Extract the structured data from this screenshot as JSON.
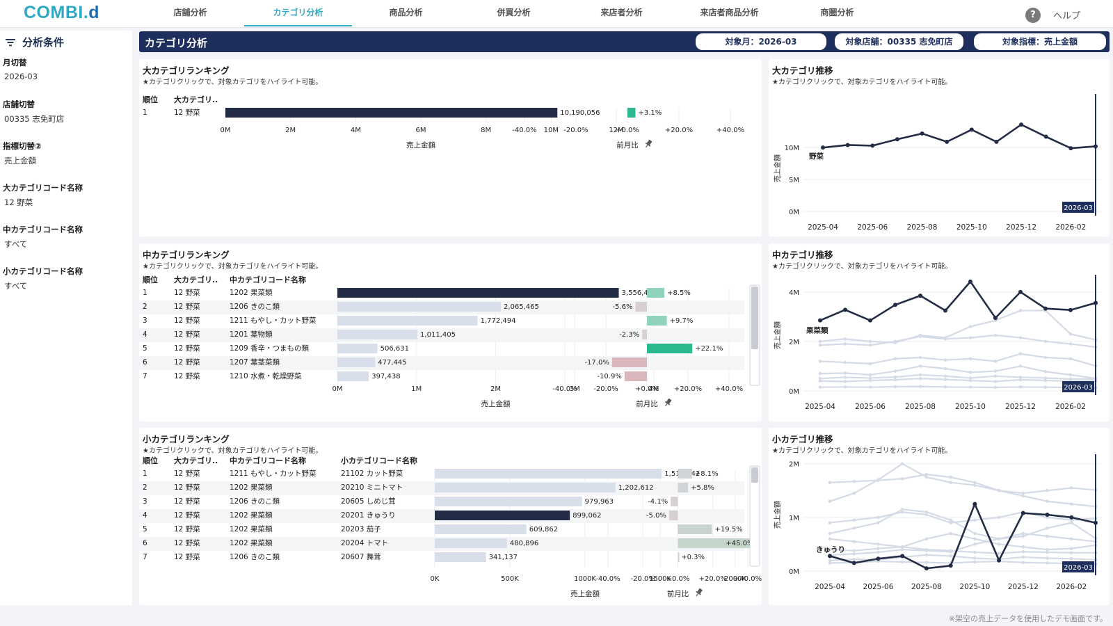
{
  "app": {
    "logo_main": "COMBI.",
    "logo_accent": "d",
    "help_label": "ヘルプ",
    "help_icon": "question-circle-icon"
  },
  "nav": {
    "tabs": [
      "店舗分析",
      "カテゴリ分析",
      "商品分析",
      "併買分析",
      "来店者分析",
      "来店者商品分析",
      "商圏分析"
    ],
    "active": 1
  },
  "sidebar": {
    "title": "分析条件",
    "filters": [
      {
        "label": "月切替",
        "value": "2026-03"
      },
      {
        "label": "店舗切替",
        "value": "00335 志免町店"
      },
      {
        "label": "指標切替②",
        "value": "売上金額"
      },
      {
        "label": "大カテゴリコード名称",
        "value": "12 野菜"
      },
      {
        "label": "中カテゴリコード名称",
        "value": "すべて"
      },
      {
        "label": "小カテゴリコード名称",
        "value": "すべて"
      }
    ]
  },
  "header": {
    "title": "カテゴリ分析",
    "chips": [
      "対象月：2026-03",
      "対象店舗：00335 志免町店",
      "対象指標：売上金額"
    ]
  },
  "hint": "★カテゴリクリックで、対象カテゴリをハイライト可能。",
  "colors": {
    "navy": "#1e2f5d",
    "bar_dark": "#222d45",
    "bar_light": "#d8dfeb",
    "pos": "#2cb88f",
    "pos_light": "#8fd3bd",
    "neg_light": "#d9b7bd",
    "neg_grey": "#d8cfd2",
    "gray_bar": "#cfd4d6",
    "line_light": "#d5dbe6"
  },
  "ranking_large": {
    "title": "大カテゴリランキング",
    "headers": [
      "順位",
      "大カテゴリ.."
    ],
    "rows": [
      {
        "rank": "1",
        "cat1": "12 野菜",
        "value": 10190056,
        "value_label": "10,190,056",
        "mom": 3.1,
        "mom_label": "+3.1%"
      }
    ],
    "x_ticks": [
      "0M",
      "2M",
      "4M",
      "6M",
      "8M",
      "10M",
      "12M"
    ],
    "x_max": 12000000,
    "mom_ticks": [
      "-40.0%",
      "-20.0%",
      "+0.0%",
      "+20.0%",
      "+40.0%"
    ],
    "x_title": "売上金額",
    "mom_title": "前月比"
  },
  "ranking_mid": {
    "title": "中カテゴリランキング",
    "headers": [
      "順位",
      "大カテゴリ..",
      "中カテゴリコード名称"
    ],
    "rows": [
      {
        "rank": "1",
        "cat1": "12 野菜",
        "cat2": "1202 果菜類",
        "value": 3556473,
        "value_label": "3,556,473",
        "mom": 8.5,
        "mom_label": "+8.5%"
      },
      {
        "rank": "2",
        "cat1": "12 野菜",
        "cat2": "1206 きのこ類",
        "value": 2065465,
        "value_label": "2,065,465",
        "mom": -5.6,
        "mom_label": "-5.6%"
      },
      {
        "rank": "3",
        "cat1": "12 野菜",
        "cat2": "1211 もやし・カット野菜",
        "value": 1772494,
        "value_label": "1,772,494",
        "mom": 9.7,
        "mom_label": "+9.7%"
      },
      {
        "rank": "4",
        "cat1": "12 野菜",
        "cat2": "1201 葉物類",
        "value": 1011405,
        "value_label": "1,011,405",
        "mom": -2.3,
        "mom_label": "-2.3%"
      },
      {
        "rank": "5",
        "cat1": "12 野菜",
        "cat2": "1209 香辛・つまもの類",
        "value": 506631,
        "value_label": "506,631",
        "mom": 22.1,
        "mom_label": "+22.1%"
      },
      {
        "rank": "6",
        "cat1": "12 野菜",
        "cat2": "1207 葉茎菜類",
        "value": 477445,
        "value_label": "477,445",
        "mom": -17.0,
        "mom_label": "-17.0%"
      },
      {
        "rank": "7",
        "cat1": "12 野菜",
        "cat2": "1210 水煮・乾燥野菜",
        "value": 397438,
        "value_label": "397,438",
        "mom": -10.9,
        "mom_label": "-10.9%"
      }
    ],
    "x_ticks": [
      "0M",
      "1M",
      "2M",
      "3M",
      "4M"
    ],
    "x_max": 4000000,
    "mom_ticks": [
      "-40.0%",
      "-20.0%",
      "+0.0%",
      "+20.0%",
      "+40.0%"
    ],
    "x_title": "売上金額",
    "mom_title": "前月比"
  },
  "ranking_small": {
    "title": "小カテゴリランキング",
    "headers": [
      "順位",
      "大カテゴリ..",
      "中カテゴリコード名称",
      "小カテゴリコード名称"
    ],
    "rows": [
      {
        "rank": "1",
        "cat1": "12 野菜",
        "cat2": "1211 もやし・カット野菜",
        "cat3": "21102 カット野菜",
        "value": 1510642,
        "value_label": "1,510,642",
        "mom": 8.1,
        "mom_label": "+8.1%"
      },
      {
        "rank": "2",
        "cat1": "12 野菜",
        "cat2": "1202 果菜類",
        "cat3": "20210 ミニトマト",
        "value": 1202612,
        "value_label": "1,202,612",
        "mom": 5.8,
        "mom_label": "+5.8%"
      },
      {
        "rank": "3",
        "cat1": "12 野菜",
        "cat2": "1206 きのこ類",
        "cat3": "20605 しめじ茸",
        "value": 979963,
        "value_label": "979,963",
        "mom": -4.1,
        "mom_label": "-4.1%"
      },
      {
        "rank": "4",
        "cat1": "12 野菜",
        "cat2": "1202 果菜類",
        "cat3": "20201 きゅうり",
        "value": 899062,
        "value_label": "899,062",
        "mom": -5.0,
        "mom_label": "-5.0%"
      },
      {
        "rank": "5",
        "cat1": "12 野菜",
        "cat2": "1202 果菜類",
        "cat3": "20203 茄子",
        "value": 609862,
        "value_label": "609,862",
        "mom": 19.5,
        "mom_label": "+19.5%"
      },
      {
        "rank": "6",
        "cat1": "12 野菜",
        "cat2": "1202 果菜類",
        "cat3": "20204 トマト",
        "value": 480896,
        "value_label": "480,896",
        "mom": 45.0,
        "mom_label": "+45.0%"
      },
      {
        "rank": "7",
        "cat1": "12 野菜",
        "cat2": "1206 きのこ類",
        "cat3": "20607 舞茸",
        "value": 341137,
        "value_label": "341,137",
        "mom": 0.3,
        "mom_label": "+0.3%"
      }
    ],
    "x_ticks": [
      "0K",
      "500K",
      "1000K",
      "1500K",
      "2000K"
    ],
    "x_max": 2000000,
    "mom_ticks": [
      "-40.0%",
      "-20.0%",
      "+0.0%",
      "+20.0%",
      "+40.0%"
    ],
    "x_title": "売上金額",
    "mom_title": "前月比"
  },
  "trend_large": {
    "title": "大カテゴリ推移",
    "ylabel": "売上金額",
    "y_ticks": [
      "0M",
      "5M",
      "10M"
    ],
    "y_vals": [
      0,
      5000000,
      10000000
    ],
    "y_max": 13500000,
    "x_ticks": [
      "2025-04",
      "2025-06",
      "2025-08",
      "2025-10",
      "2025-12",
      "2026-02"
    ],
    "marker": "2026-03",
    "series_label": "野菜",
    "series": [
      10000000,
      10400000,
      10300000,
      11300000,
      12200000,
      10900000,
      12800000,
      10900000,
      13600000,
      11700000,
      9900000,
      10190056
    ]
  },
  "trend_mid": {
    "title": "中カテゴリ推移",
    "ylabel": "売上金額",
    "y_ticks": [
      "0M",
      "2M",
      "4M"
    ],
    "y_vals": [
      0,
      2000000,
      4000000
    ],
    "y_max": 4500000,
    "x_ticks": [
      "2025-04",
      "2025-06",
      "2025-08",
      "2025-10",
      "2025-12",
      "2026-02"
    ],
    "marker": "2026-03",
    "series_label": "果菜類",
    "series": [
      2850000,
      3280000,
      2850000,
      3480000,
      3850000,
      3250000,
      4420000,
      2950000,
      4000000,
      3330000,
      3270000,
      3556473
    ],
    "others": [
      [
        2000000,
        2100000,
        2000000,
        1950000,
        2250000,
        2150000,
        2600000,
        2850000,
        3250000,
        3250000,
        2300000,
        2065465
      ],
      [
        1850000,
        1900000,
        1850000,
        2000000,
        2200000,
        2100000,
        2150000,
        2250000,
        2150000,
        2000000,
        1900000,
        1772494
      ],
      [
        1200000,
        1150000,
        1100000,
        1300000,
        1350000,
        1250000,
        1300000,
        1200000,
        1500000,
        1350000,
        1300000,
        1011405
      ],
      [
        700000,
        720000,
        650000,
        800000,
        1000000,
        900000,
        750000,
        800000,
        1000000,
        780000,
        650000,
        506631
      ],
      [
        500000,
        550000,
        520000,
        560000,
        650000,
        600000,
        520000,
        600000,
        550000,
        520000,
        480000,
        477445
      ],
      [
        400000,
        380000,
        420000,
        450000,
        500000,
        460000,
        420000,
        380000,
        450000,
        420000,
        390000,
        397438
      ],
      [
        150000,
        160000,
        150000,
        170000,
        180000,
        160000,
        150000,
        140000,
        160000,
        150000,
        140000,
        130000
      ]
    ]
  },
  "trend_small": {
    "title": "小カテゴリ推移",
    "ylabel": "売上金額",
    "y_ticks": [
      "0M",
      "1M",
      "2M"
    ],
    "y_vals": [
      0,
      1000000,
      2000000
    ],
    "y_max": 2100000,
    "x_ticks": [
      "2025-04",
      "2025-06",
      "2025-08",
      "2025-10",
      "2025-12",
      "2026-02"
    ],
    "marker": "2026-03",
    "series_label": "きゅうり",
    "series": [
      280000,
      150000,
      230000,
      280000,
      50000,
      100000,
      1250000,
      200000,
      1080000,
      1050000,
      1000000,
      899062
    ],
    "others": [
      [
        1650000,
        1670000,
        1690000,
        1720000,
        1800000,
        1750000,
        1650000,
        1500000,
        1450000,
        1500000,
        1550000,
        1510642
      ],
      [
        1300000,
        1450000,
        1700000,
        2000000,
        1750000,
        1650000,
        1600000,
        1500000,
        1400000,
        1300000,
        1250000,
        1202612
      ],
      [
        900000,
        950000,
        1000000,
        1100000,
        1050000,
        900000,
        950000,
        1000000,
        1100000,
        1000000,
        950000,
        979963
      ],
      [
        700000,
        800000,
        900000,
        1150000,
        1100000,
        950000,
        700000,
        600000,
        650000,
        800000,
        900000,
        609862
      ],
      [
        600000,
        550000,
        500000,
        450000,
        600000,
        700000,
        600000,
        500000,
        450000,
        400000,
        420000,
        480896
      ],
      [
        400000,
        380000,
        420000,
        450000,
        400000,
        380000,
        350000,
        330000,
        360000,
        350000,
        340000,
        341137
      ],
      [
        300000,
        320000,
        350000,
        400000,
        380000,
        360000,
        500000,
        600000,
        700000,
        650000,
        600000,
        550000
      ],
      [
        200000,
        220000,
        210000,
        260000,
        300000,
        280000,
        240000,
        220000,
        260000,
        240000,
        230000,
        210000
      ],
      [
        150000,
        160000,
        180000,
        170000,
        160000,
        150000,
        170000,
        180000,
        160000,
        150000,
        140000,
        130000
      ]
    ]
  },
  "footnote": "※架空の売上データを使用したデモ画面です。"
}
